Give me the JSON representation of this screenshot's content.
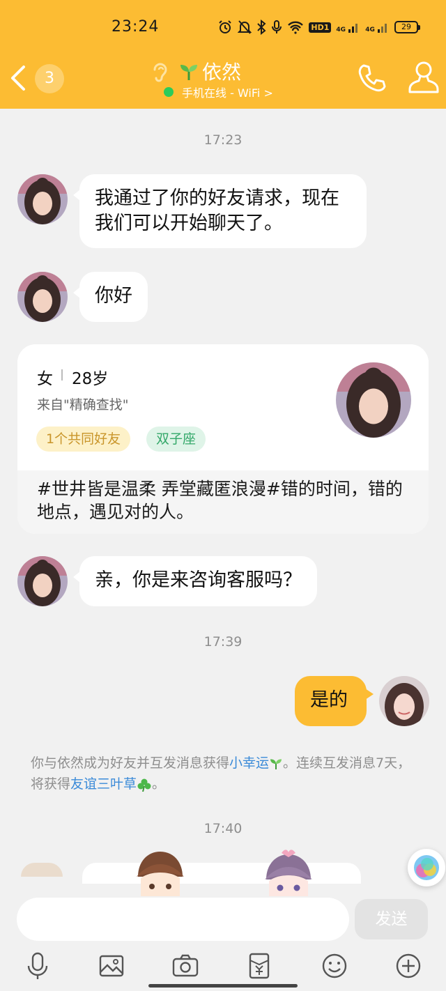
{
  "status_bar": {
    "time": "23:24",
    "network": "4G",
    "network2": "4G",
    "hd": "HD1",
    "battery": "29"
  },
  "header": {
    "unread_count": "3",
    "contact_name": "依然",
    "online_status": "手机在线 - WiFi",
    "chevron": ">"
  },
  "messages": {
    "ts1": "17:23",
    "m1": "我通过了你的好友请求，现在我们可以开始聊天了。",
    "m2": "你好",
    "m3": "亲，你是来咨询客服吗？",
    "ts2": "17:39",
    "m4": "是的",
    "ts3": "17:40"
  },
  "profile_card": {
    "gender": "女",
    "age": "28岁",
    "source": "来自\"精确查找\"",
    "tag_friends": "1个共同好友",
    "tag_zodiac": "双子座",
    "signature": "#世井皆是温柔 弄堂藏匿浪漫#错的时间，错的地点，遇见对的人。"
  },
  "system_notice": {
    "p1": "你与依然成为好友并互发消息获得",
    "link1": "小幸运",
    "p2": "。连续互发消息7天，将获得",
    "link2": "友谊三叶草",
    "p3": "。"
  },
  "input_bar": {
    "send_label": "发送"
  },
  "icons": [
    "back-icon",
    "ear-icon",
    "sprout-icon",
    "phone-icon",
    "profile-icon",
    "mic-icon",
    "image-icon",
    "camera-icon",
    "red-packet-icon",
    "emoji-icon",
    "plus-icon"
  ],
  "colors": {
    "accent": "#fcbc33",
    "online": "#2ccb5a",
    "link": "#3a8ad8"
  }
}
